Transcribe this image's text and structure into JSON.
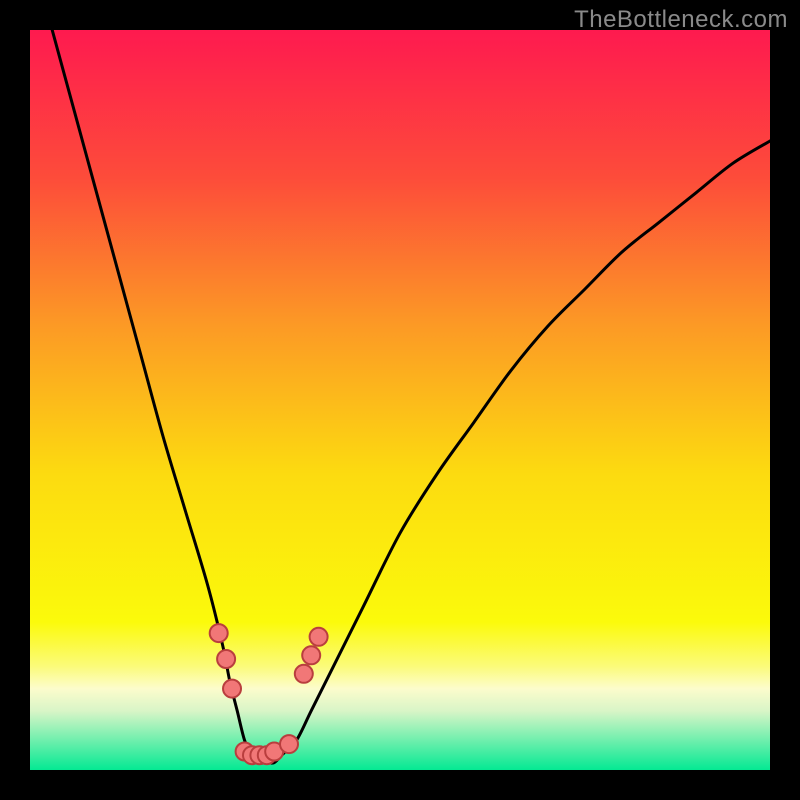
{
  "watermark": "TheBottleneck.com",
  "chart_data": {
    "type": "line",
    "title": "",
    "xlabel": "",
    "ylabel": "",
    "xlim": [
      0,
      100
    ],
    "ylim": [
      0,
      100
    ],
    "grid": false,
    "legend": false,
    "gradient_stops": [
      {
        "pos": 0.0,
        "color": "#fe1a4f"
      },
      {
        "pos": 0.2,
        "color": "#fd4c3a"
      },
      {
        "pos": 0.4,
        "color": "#fc9a25"
      },
      {
        "pos": 0.6,
        "color": "#fcdb10"
      },
      {
        "pos": 0.8,
        "color": "#fbfa0b"
      },
      {
        "pos": 0.86,
        "color": "#fbfb7a"
      },
      {
        "pos": 0.89,
        "color": "#fcfccc"
      },
      {
        "pos": 0.92,
        "color": "#d9f5c7"
      },
      {
        "pos": 1.0,
        "color": "#04e993"
      }
    ],
    "series": [
      {
        "name": "bottleneck-curve",
        "color": "#000000",
        "x": [
          3,
          6,
          9,
          12,
          15,
          18,
          21,
          24,
          26,
          27,
          28,
          29,
          30,
          31,
          32,
          33,
          34,
          36,
          38,
          41,
          45,
          50,
          55,
          60,
          65,
          70,
          75,
          80,
          85,
          90,
          95,
          100
        ],
        "y": [
          100,
          89,
          78,
          67,
          56,
          45,
          35,
          25,
          17,
          12,
          8,
          4,
          2,
          1,
          1,
          1,
          2,
          4,
          8,
          14,
          22,
          32,
          40,
          47,
          54,
          60,
          65,
          70,
          74,
          78,
          82,
          85
        ]
      }
    ],
    "markers": [
      {
        "x": 25.5,
        "y": 18.5
      },
      {
        "x": 26.5,
        "y": 15.0
      },
      {
        "x": 27.3,
        "y": 11.0
      },
      {
        "x": 29.0,
        "y": 2.5
      },
      {
        "x": 30.0,
        "y": 2.0
      },
      {
        "x": 31.0,
        "y": 2.0
      },
      {
        "x": 32.0,
        "y": 2.0
      },
      {
        "x": 33.0,
        "y": 2.5
      },
      {
        "x": 35.0,
        "y": 3.5
      },
      {
        "x": 37.0,
        "y": 13.0
      },
      {
        "x": 38.0,
        "y": 15.5
      },
      {
        "x": 39.0,
        "y": 18.0
      }
    ],
    "marker_style": {
      "fill": "#f17777",
      "stroke": "#b93e3e",
      "radius_px": 9
    }
  }
}
